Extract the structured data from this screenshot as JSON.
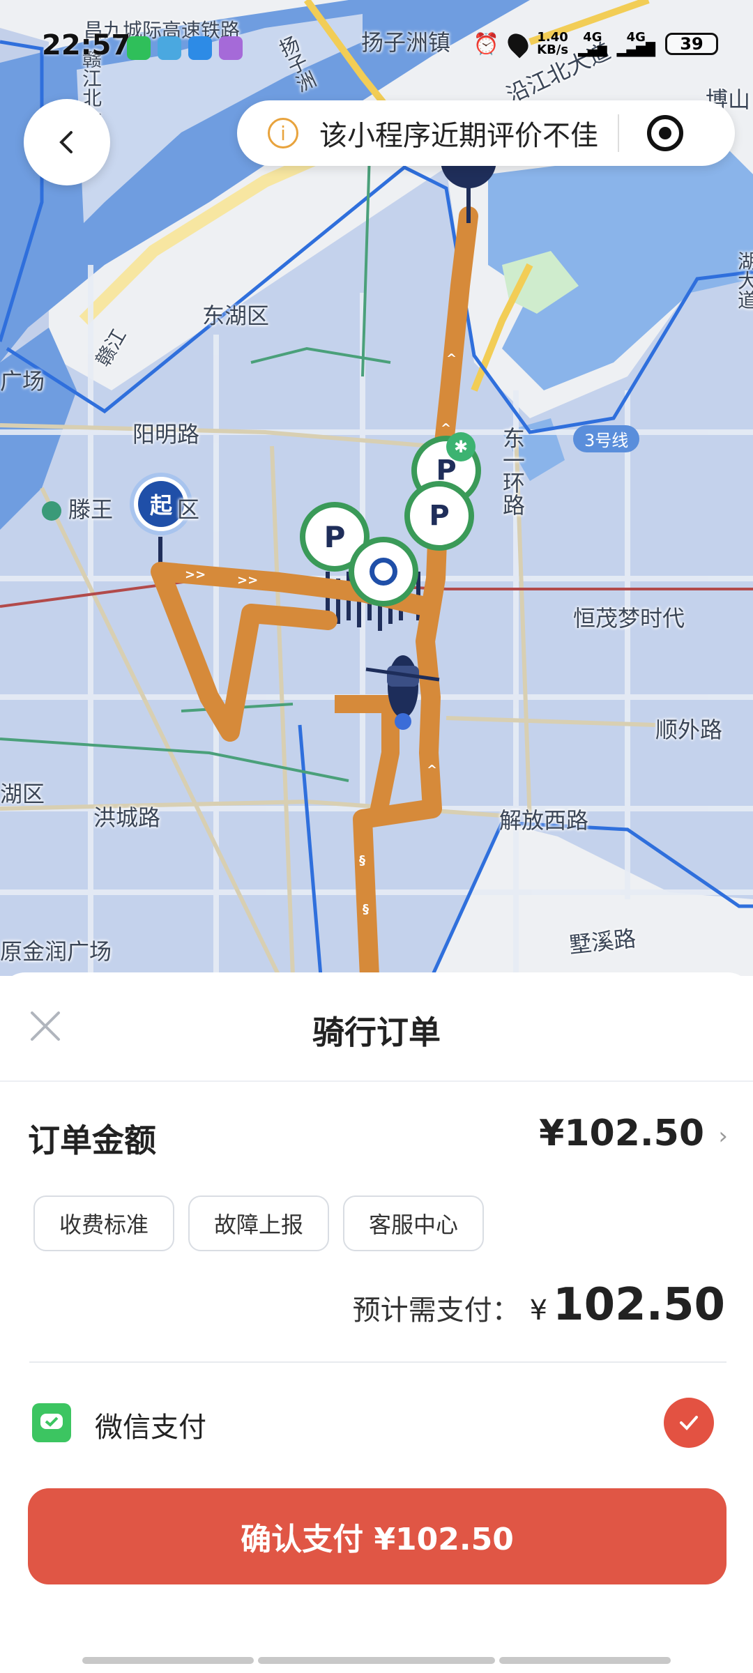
{
  "status_bar": {
    "time": "22:57",
    "net_speed": "1.40",
    "net_unit": "KB/s",
    "signal1": "4G",
    "signal2": "4G",
    "battery": "39"
  },
  "map": {
    "labels": {
      "rail": "昌九城际高速铁路",
      "town": "扬子洲镇",
      "road_yangzizhou": "扬子洲",
      "road_ganjiang": "赣江北大道",
      "yanjiang": "沿江北大道",
      "boshan": "博山",
      "donghu": "东湖区",
      "ganjiang": "赣江",
      "guangchang": "广场",
      "yangming": "阳明路",
      "tengwang": "滕王",
      "tengwang_suffix": "区",
      "dongyi": "东一环路",
      "line3": "3号线",
      "hengmao": "恒茂梦时代",
      "shunwai": "顺外路",
      "huqu": "湖区",
      "hongcheng": "洪城路",
      "jiefangxi": "解放西路",
      "jinrun": "原金润广场",
      "shuxi": "墅溪路",
      "east_road": "湖大道",
      "start_marker": "起",
      "parking": "P"
    }
  },
  "top_bar": {
    "notice_text": "该小程序近期评价不佳"
  },
  "sheet": {
    "title": "骑行订单",
    "amount_label": "订单金额",
    "amount_value": "¥102.50",
    "chips": [
      "收费标准",
      "故障上报",
      "客服中心"
    ],
    "pay_label": "预计需支付：",
    "pay_currency": "¥",
    "pay_value": "102.50",
    "payment_method": "微信支付",
    "confirm_label": "确认支付 ¥102.50"
  },
  "colors": {
    "route": "#d68a3a",
    "accent": "#e05645",
    "map_blue": "#bfcde8",
    "water": "#5d8bd6"
  }
}
